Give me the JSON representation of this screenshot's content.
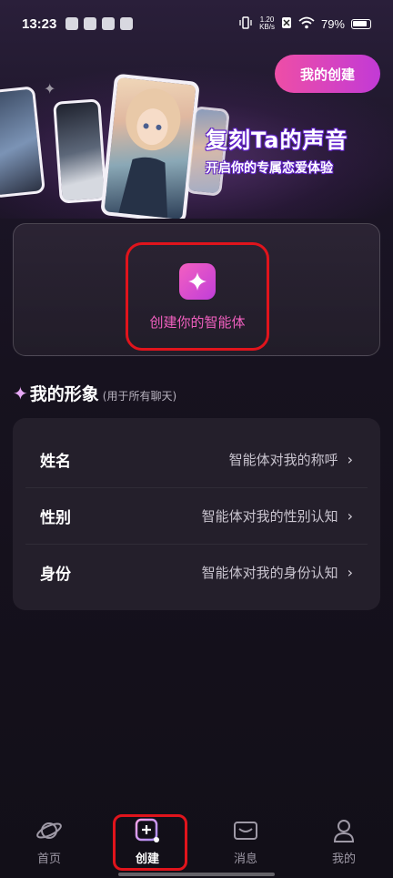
{
  "status_bar": {
    "time": "13:23",
    "net_speed_value": "1.20",
    "net_speed_unit": "KB/s",
    "battery": "79%"
  },
  "banner": {
    "title": "复刻Ta的声音",
    "subtitle": "开启你的专属恋爱体验"
  },
  "header": {
    "my_creations_label": "我的创建"
  },
  "create": {
    "label": "创建你的智能体"
  },
  "my_image": {
    "title": "我的形象",
    "note": "(用于所有聊天)",
    "rows": [
      {
        "label": "姓名",
        "value": "智能体对我的称呼"
      },
      {
        "label": "性别",
        "value": "智能体对我的性别认知"
      },
      {
        "label": "身份",
        "value": "智能体对我的身份认知"
      }
    ]
  },
  "bottom_nav": {
    "items": [
      {
        "label": "首页",
        "icon": "planet-icon"
      },
      {
        "label": "创建",
        "icon": "create-plus-icon"
      },
      {
        "label": "消息",
        "icon": "message-icon"
      },
      {
        "label": "我的",
        "icon": "profile-icon"
      }
    ]
  },
  "colors": {
    "accent_pink": "#ee4ea6",
    "accent_purple": "#c23ad6",
    "highlight_red": "#e0141c"
  }
}
